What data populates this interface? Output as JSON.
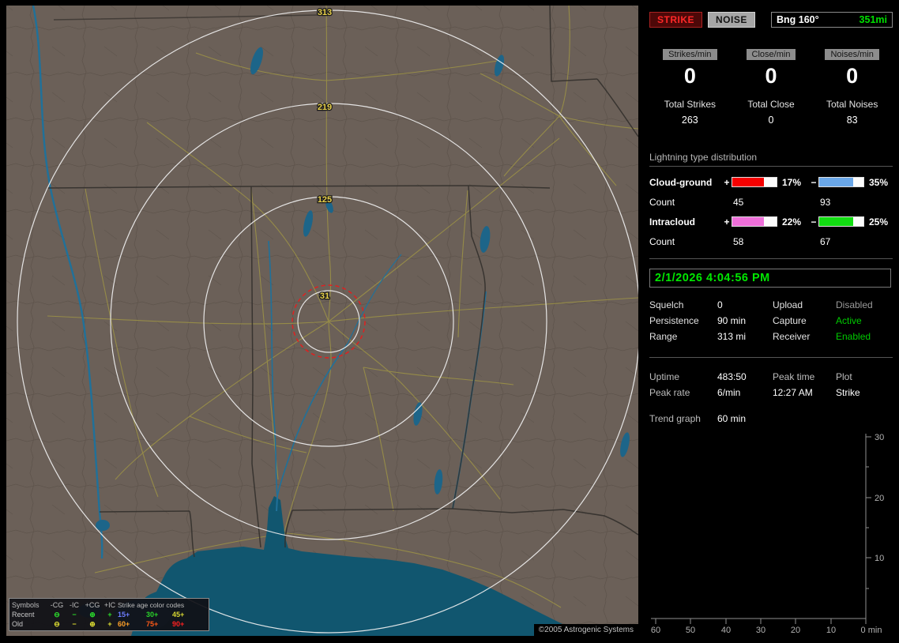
{
  "colors": {
    "land": "#6b6058",
    "water": "#11566f",
    "roads": "#9d9346",
    "range_ring": "#f0f0f0",
    "alarm_ring": "#e02020",
    "strike_accent": "#ff2828",
    "active_green": "#00cc00",
    "clock_green": "#00e800"
  },
  "map": {
    "range_labels": [
      "313",
      "219",
      "125",
      "31"
    ],
    "copyright": "©2005 Astrogenic Systems",
    "legend": {
      "col_headers": [
        "Symbols",
        "-CG",
        "-IC",
        "+CG",
        "+IC"
      ],
      "age_header": "Strike age color codes",
      "symbols": [
        "⊖",
        "−",
        "⊕",
        "+"
      ],
      "rows": [
        {
          "label": "Recent",
          "symbol_style": "color:#2ce02c",
          "ages": [
            {
              "text": "15+",
              "style": "color:#6d7dff"
            },
            {
              "text": "30+",
              "style": "color:#2ad42a"
            },
            {
              "text": "45+",
              "style": "color:#d8d832"
            }
          ]
        },
        {
          "label": "Old",
          "symbol_style": "color:#e2e232",
          "ages": [
            {
              "text": "60+",
              "style": "color:#ffa028"
            },
            {
              "text": "75+",
              "style": "color:#ff5a18"
            },
            {
              "text": "90+",
              "style": "color:#ff2020"
            }
          ]
        }
      ]
    }
  },
  "panel": {
    "strike_button": "STRIKE",
    "noise_button": "NOISE",
    "bearing_label": "Bng 160°",
    "bearing_value": "351mi",
    "rate_boxes": [
      {
        "label": "Strikes/min",
        "value": "0"
      },
      {
        "label": "Close/min",
        "value": "0"
      },
      {
        "label": "Noises/min",
        "value": "0"
      }
    ],
    "totals": [
      {
        "label": "Total Strikes",
        "value": "263"
      },
      {
        "label": "Total Close",
        "value": "0"
      },
      {
        "label": "Total Noises",
        "value": "83"
      }
    ],
    "distribution": {
      "title": "Lightning type distribution",
      "plus_sign": "+",
      "minus_sign": "−",
      "count_label": "Count",
      "rows": [
        {
          "label": "Cloud-ground",
          "plus_pct": "17%",
          "plus_count": "45",
          "plus_fill_style": "width:72%;background:#f50000",
          "minus_pct": "35%",
          "minus_count": "93",
          "minus_fill_style": "width:76%;background:#6aa7e8"
        },
        {
          "label": "Intracloud",
          "plus_pct": "22%",
          "plus_count": "58",
          "plus_fill_style": "width:72%;background:#ee6fd9",
          "minus_pct": "25%",
          "minus_count": "67",
          "minus_fill_style": "width:76%;background:#12dd12"
        }
      ]
    },
    "datetime": "2/1/2026 4:04:56 PM",
    "settings": {
      "rows": [
        {
          "l1": "Squelch",
          "v1": "0",
          "l2": "Upload",
          "v2": "Disabled"
        },
        {
          "l1": "Persistence",
          "v1": "90 min",
          "l2": "Capture",
          "v2": "Active"
        },
        {
          "l1": "Range",
          "v1": "313 mi",
          "l2": "Receiver",
          "v2": "Enabled"
        }
      ]
    },
    "stats": {
      "uptime_label": "Uptime",
      "uptime": "483:50",
      "peaktime_label": "Peak time",
      "plot_label": "Plot",
      "peakrate_label": "Peak rate",
      "peakrate": "6/min",
      "peaktime": "12:27 AM",
      "plot": "Strike",
      "trend_label": "Trend graph",
      "trend_value": "60 min"
    },
    "trend": {
      "y_ticks": [
        "30",
        "20",
        "10"
      ],
      "x_ticks": [
        "60",
        "50",
        "40",
        "30",
        "20",
        "10",
        "0 min"
      ]
    }
  }
}
